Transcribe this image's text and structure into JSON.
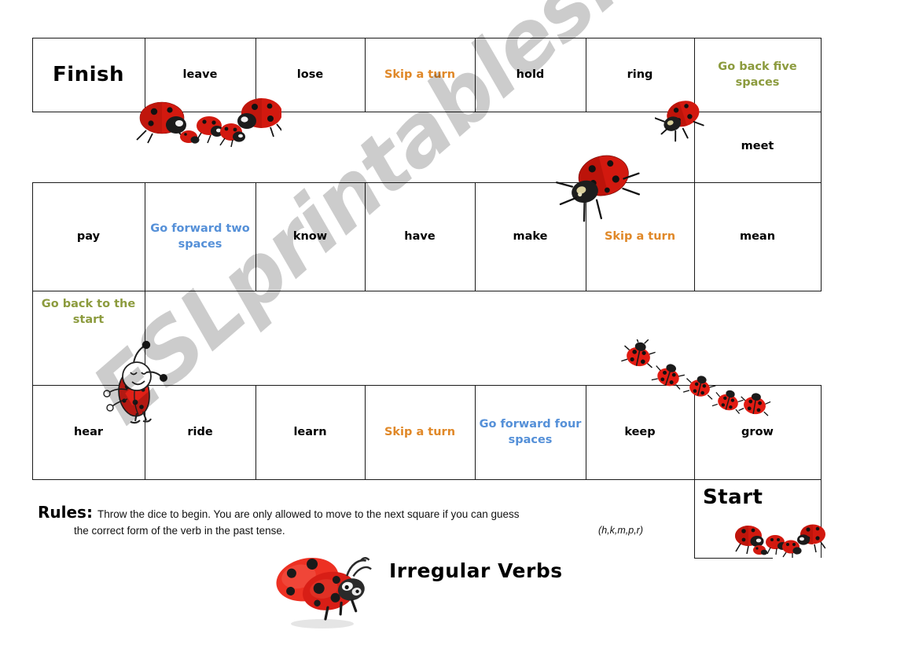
{
  "worksheet": {
    "title": "Irregular Verbs",
    "watermark": "ESLprintables.com"
  },
  "board": {
    "start_label": "Start",
    "finish_label": "Finish",
    "rows": [
      {
        "name": "row-1",
        "cells": [
          {
            "label": "Finish",
            "kind": "terminal"
          },
          {
            "label": "leave",
            "kind": "verb"
          },
          {
            "label": "lose",
            "kind": "verb"
          },
          {
            "label": "Skip a turn",
            "kind": "action-orange"
          },
          {
            "label": "hold",
            "kind": "verb"
          },
          {
            "label": "ring",
            "kind": "verb"
          },
          {
            "label": "Go back five spaces",
            "kind": "action-green"
          }
        ]
      },
      {
        "name": "connector-1",
        "cells": [
          {
            "label": "meet",
            "kind": "verb"
          }
        ]
      },
      {
        "name": "row-2",
        "cells": [
          {
            "label": "pay",
            "kind": "verb"
          },
          {
            "label": "Go forward two spaces",
            "kind": "action-blue"
          },
          {
            "label": "know",
            "kind": "verb"
          },
          {
            "label": "have",
            "kind": "verb"
          },
          {
            "label": "make",
            "kind": "verb"
          },
          {
            "label": "Skip a turn",
            "kind": "action-orange"
          },
          {
            "label": "mean",
            "kind": "verb"
          }
        ]
      },
      {
        "name": "connector-2",
        "cells": [
          {
            "label": "Go back to the start",
            "kind": "action-green"
          }
        ]
      },
      {
        "name": "row-3",
        "cells": [
          {
            "label": "hear",
            "kind": "verb"
          },
          {
            "label": "ride",
            "kind": "verb"
          },
          {
            "label": "learn",
            "kind": "verb"
          },
          {
            "label": "Skip a turn",
            "kind": "action-orange"
          },
          {
            "label": "Go forward four spaces",
            "kind": "action-blue"
          },
          {
            "label": "keep",
            "kind": "verb"
          },
          {
            "label": "grow",
            "kind": "verb"
          }
        ]
      },
      {
        "name": "start-row",
        "cells": [
          {
            "label": "Start",
            "kind": "terminal"
          }
        ]
      }
    ]
  },
  "rules": {
    "label": "Rules:",
    "line1": "Throw the dice to begin. You are only allowed to move to the next square if you can guess",
    "line2": "the correct  form of the verb in the past tense.",
    "hint": "(h,k,m,p,r)"
  },
  "colors": {
    "orange": "#E08828",
    "blue": "#5590D8",
    "green": "#8C9B3E",
    "ink": "#000000",
    "rule_line": "#1a1a1a",
    "ladybug_red": "#D81E16",
    "ladybug_dark": "#1a1a1a",
    "watermark": "rgba(0,0,0,0.20)"
  },
  "decorations": [
    {
      "name": "ladybug-cluster-top-left",
      "icon": "ladybug-group-icon"
    },
    {
      "name": "ladybug-top-right",
      "icon": "ladybug-icon"
    },
    {
      "name": "ladybug-center-large",
      "icon": "ladybug-icon"
    },
    {
      "name": "ladybug-cartoon-left",
      "icon": "ladybug-cartoon-icon"
    },
    {
      "name": "ladybug-trail-right",
      "icon": "ladybug-trail-icon"
    },
    {
      "name": "ladybug-cluster-start",
      "icon": "ladybug-group-icon"
    },
    {
      "name": "ladybug-title",
      "icon": "ladybug-cartoon-big-icon"
    }
  ]
}
